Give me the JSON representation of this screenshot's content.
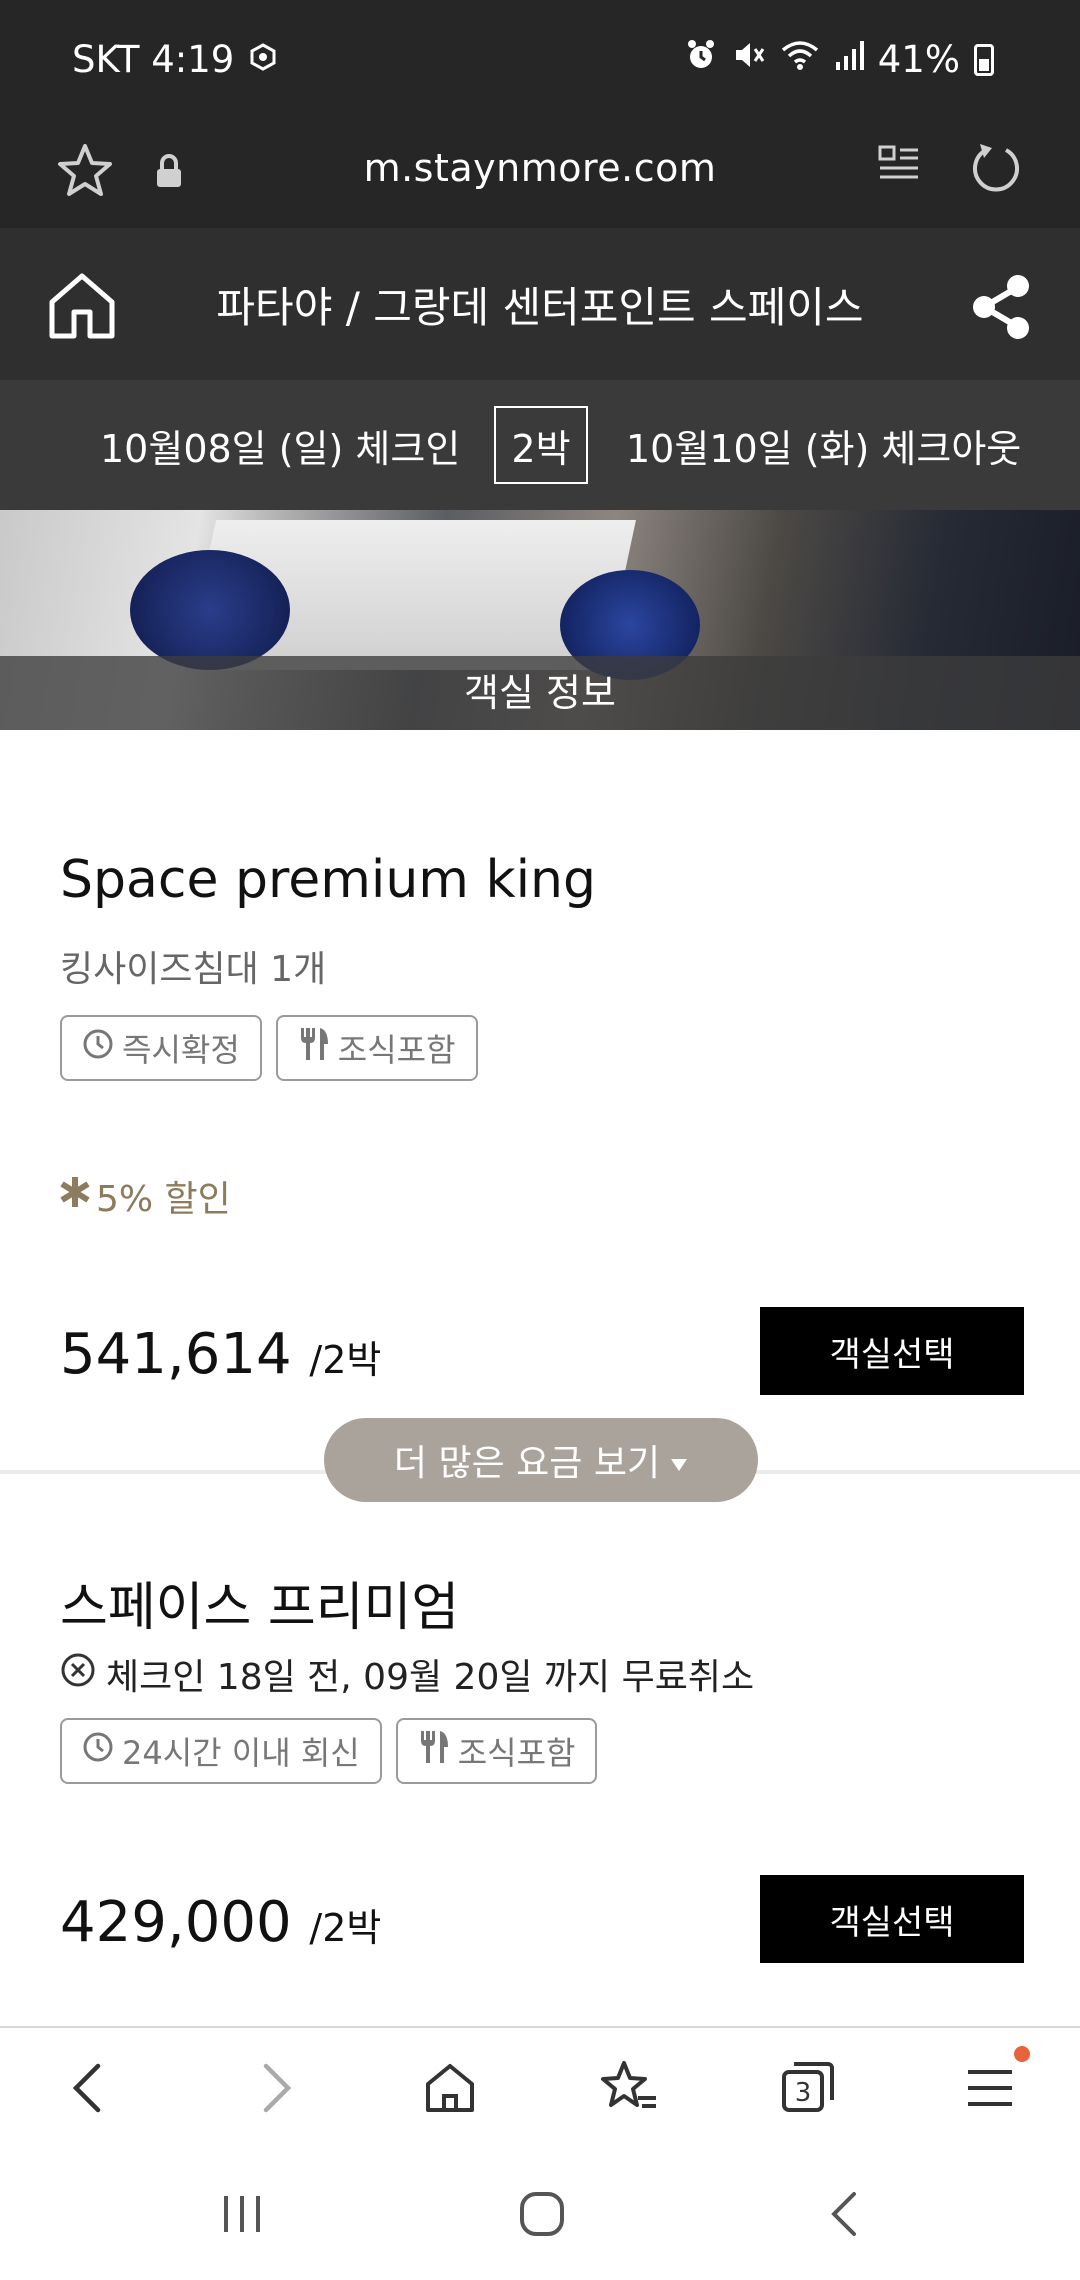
{
  "status_bar": {
    "carrier_time": "SKT 4:19",
    "battery": "41%",
    "icons": [
      "settings-icon",
      "alarm-icon",
      "mute-icon",
      "wifi-icon",
      "signal-icon",
      "battery-icon"
    ]
  },
  "browser": {
    "url": "m.staynmore.com",
    "icons": [
      "star-icon",
      "lock-icon",
      "reader-mode-icon",
      "reload-icon"
    ]
  },
  "header": {
    "title": "파타야 / 그랑데 센터포인트 스페이스",
    "icons": [
      "home-icon",
      "share-icon"
    ]
  },
  "dates": {
    "checkin": "10월08일 (일) 체크인",
    "nights": "2박",
    "checkout": "10월10일 (화) 체크아웃"
  },
  "hero": {
    "label": "객실 정보"
  },
  "rooms": [
    {
      "name": "Space premium king",
      "description": "킹사이즈침대 1개",
      "tags": [
        {
          "icon": "clock-icon",
          "label": "즉시확정"
        },
        {
          "icon": "cutlery-icon",
          "label": "조식포함"
        }
      ],
      "discount": "5% 할인",
      "price": "541,614",
      "per": "/2박",
      "button": "객실선택"
    },
    {
      "name": "스페이스 프리미엄",
      "policy": "체크인 18일 전, 09월 20일 까지 무료취소",
      "tags": [
        {
          "icon": "clock-icon",
          "label": "24시간 이내 회신"
        },
        {
          "icon": "cutlery-icon",
          "label": "조식포함"
        }
      ],
      "price": "429,000",
      "per": "/2박",
      "button": "객실선택"
    }
  ],
  "more_rates": "더 많은 요금 보기",
  "browser_nav": {
    "icons": [
      "back-icon",
      "forward-icon",
      "home-icon",
      "bookmarks-icon",
      "tabs-icon",
      "menu-icon"
    ],
    "tab_count": "3"
  },
  "system_nav": {
    "icons": [
      "recent-apps-icon",
      "home-button-icon",
      "back-icon"
    ]
  },
  "colors": {
    "status_bg": "#262626",
    "header_bg": "#2f2f2f",
    "datebar_bg": "#3a3a3a",
    "accent_discount": "#8c7b5c",
    "more_button_bg": "#a9a39c",
    "notification_dot": "#e8623a"
  }
}
